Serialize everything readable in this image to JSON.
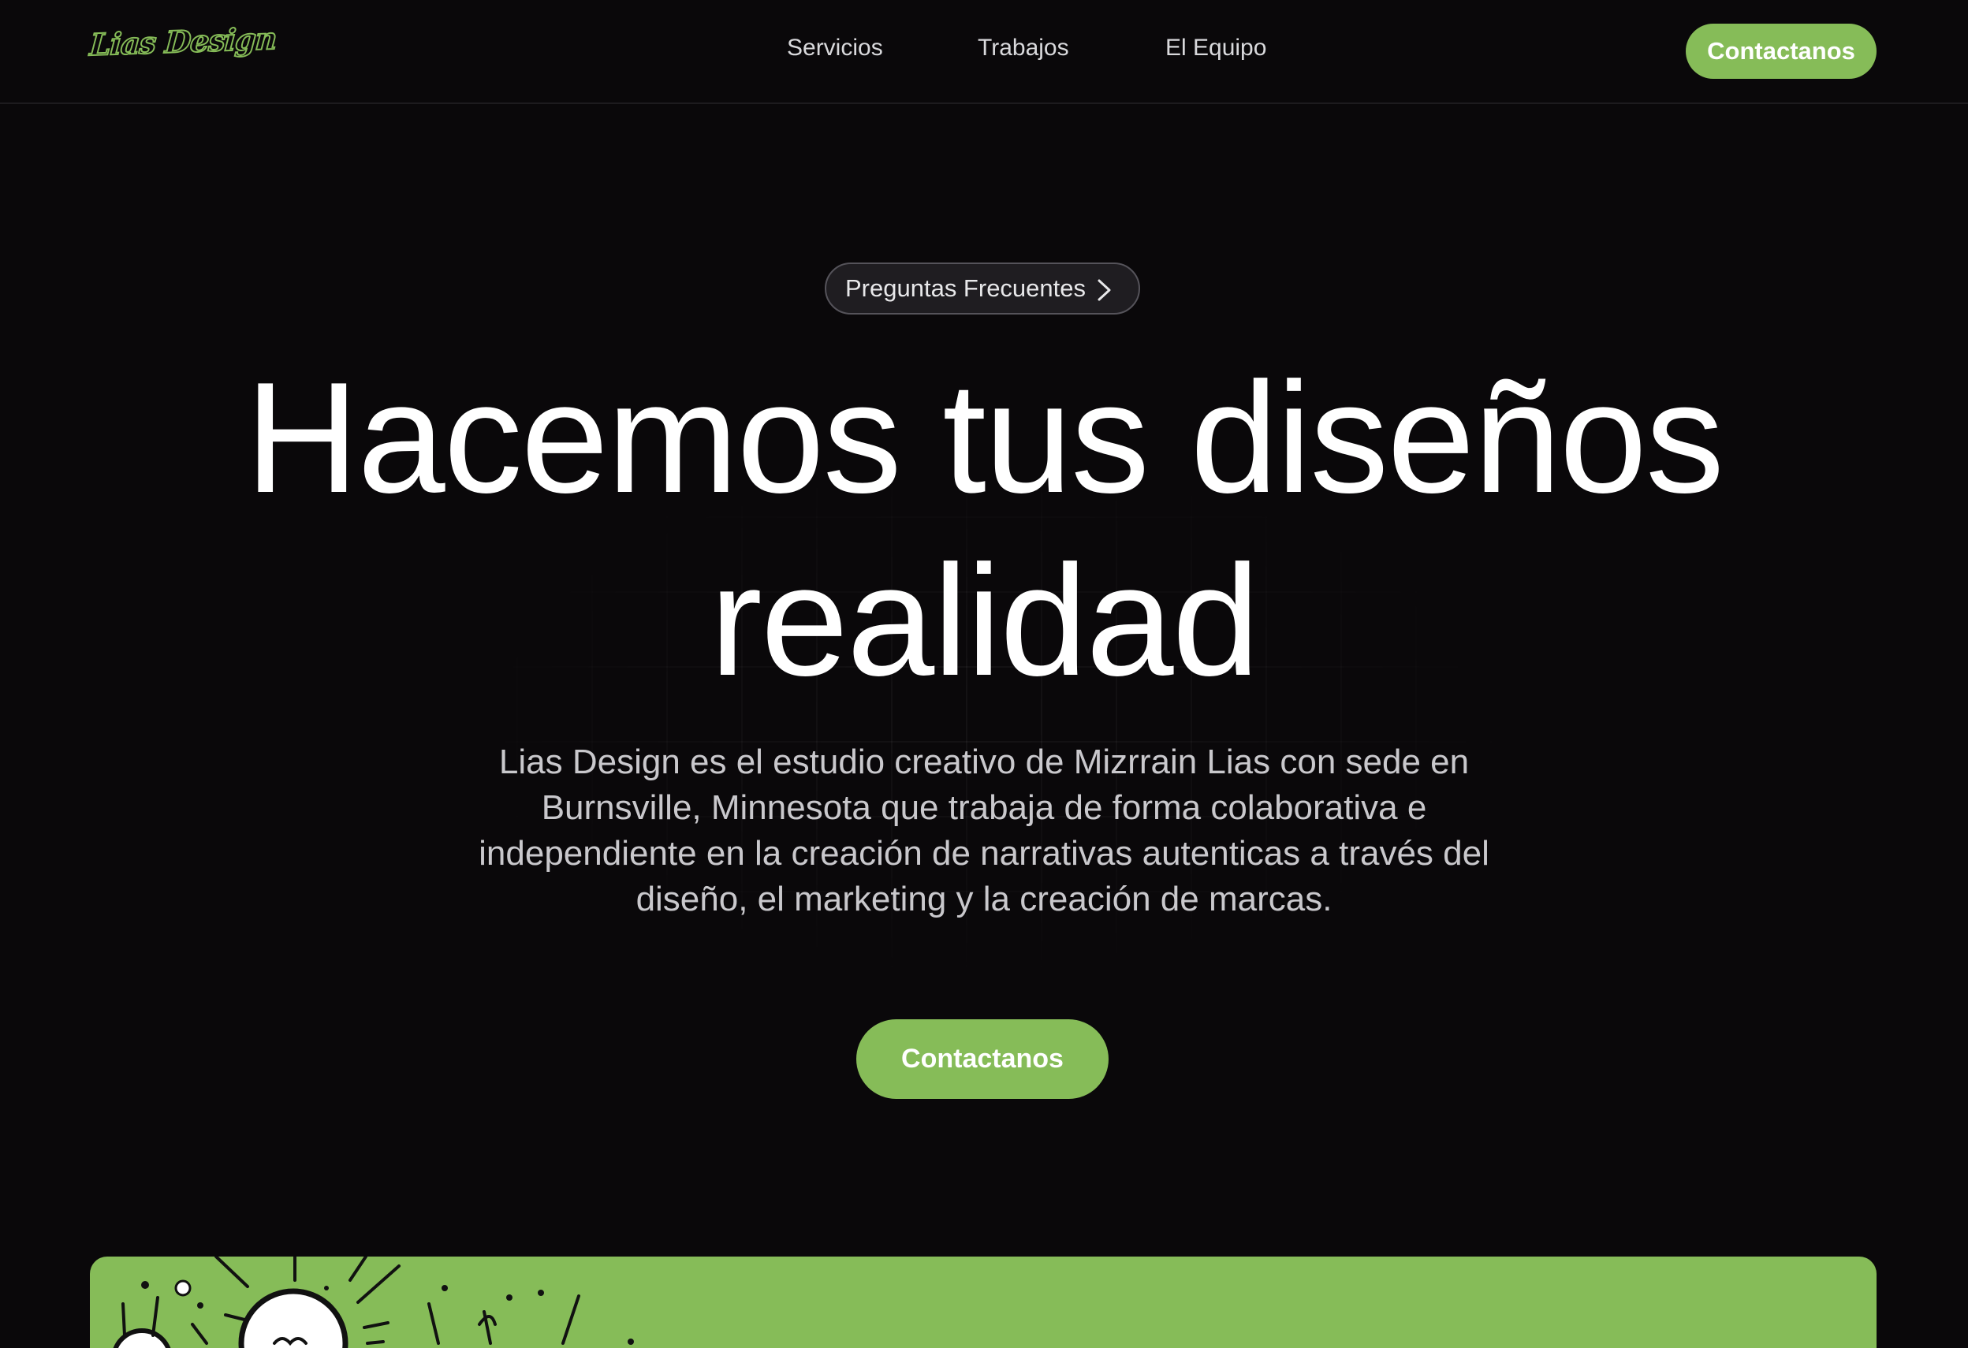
{
  "header": {
    "logo": "Lias Design",
    "nav": [
      "Servicios",
      "Trabajos",
      "El Equipo"
    ],
    "cta": "Contactanos"
  },
  "hero": {
    "faq_pill": "Preguntas Frecuentes",
    "title_line1": "Hacemos tus diseños",
    "title_line2": "realidad",
    "description": "Lias Design es el estudio creativo de Mizrrain Lias con sede en Burnsville, Minnesota que trabaja de forma colaborativa e independiente en la creación de narrativas autenticas a través del diseño, el marketing y la creación de marcas.",
    "cta": "Contactanos"
  },
  "colors": {
    "accent": "#86bc58",
    "background": "#0a080a"
  },
  "icons": {
    "faq_pill": "chevron-right-icon",
    "card_art": "light-bulb-icon"
  }
}
